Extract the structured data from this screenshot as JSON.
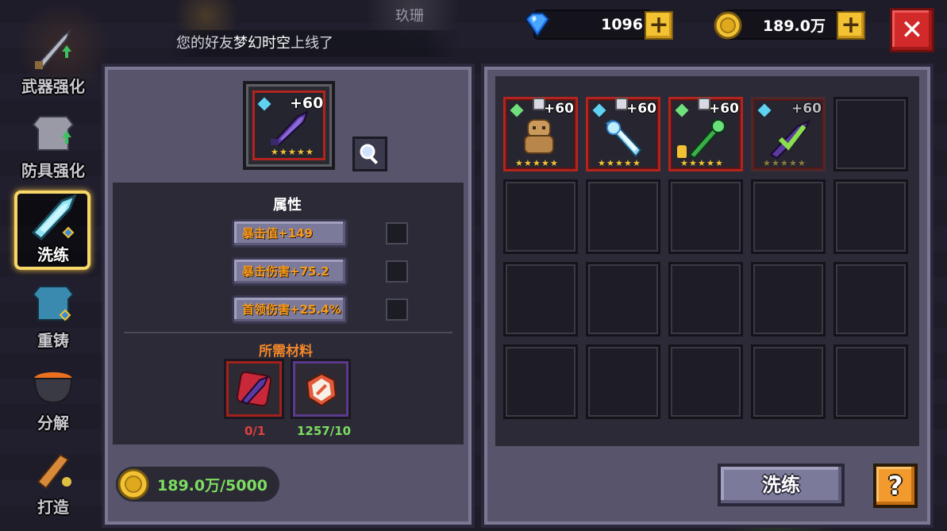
{
  "top": {
    "notice_prefix": "您的好友",
    "notice_friend": "梦幻时空",
    "notice_suffix": "上线了",
    "player_tag": "玖珊",
    "gems": "1096",
    "gold": "189.0万"
  },
  "sidebar": {
    "items": [
      {
        "label": "武器强化",
        "icon": "sword-up-icon"
      },
      {
        "label": "防具强化",
        "icon": "armor-up-icon"
      },
      {
        "label": "洗练",
        "icon": "blue-crystal-sword-icon",
        "active": true
      },
      {
        "label": "重铸",
        "icon": "blue-armor-icon"
      },
      {
        "label": "分解",
        "icon": "cauldron-icon"
      },
      {
        "label": "打造",
        "icon": "forge-hammer-icon"
      }
    ]
  },
  "selected_item": {
    "level": "+60",
    "stars": 5,
    "icon": "purple-sword-icon"
  },
  "attributes": {
    "title": "属性",
    "rows": [
      {
        "label": "暴击值+149"
      },
      {
        "label": "暴击伤害+75.2"
      },
      {
        "label": "首领伤害+25.4%"
      }
    ]
  },
  "materials": {
    "title": "所需材料",
    "items": [
      {
        "icon": "purple-sword-material-icon",
        "count": "0/1",
        "count_color": "#e04040"
      },
      {
        "icon": "refine-stone-icon",
        "count": "1257/10",
        "count_color": "#7ddd62"
      }
    ]
  },
  "cost": {
    "gold": "189.0万/5000"
  },
  "inventory": {
    "items": [
      {
        "level": "+60",
        "stars": 5,
        "icon": "cookie-figure-icon",
        "gem": "#6fe07a",
        "locked": false,
        "equipped": true
      },
      {
        "level": "+60",
        "stars": 5,
        "icon": "ice-crystal-sword-icon",
        "gem": "#5fd2f0",
        "locked": false,
        "equipped": true
      },
      {
        "level": "+60",
        "stars": 5,
        "icon": "green-staff-icon",
        "gem": "#6fe07a",
        "locked": true,
        "equipped": true
      },
      {
        "level": "+60",
        "stars": 5,
        "icon": "purple-sword-icon",
        "gem": "#5fd2f0",
        "locked": false,
        "equipped": false
      }
    ],
    "total_slots": 20
  },
  "buttons": {
    "wash": "洗练",
    "help": "?",
    "close": "✕"
  },
  "colors": {
    "accent_gold": "#f2c233",
    "rare_border": "#b3241e",
    "attr_text": "#f79a1e"
  }
}
